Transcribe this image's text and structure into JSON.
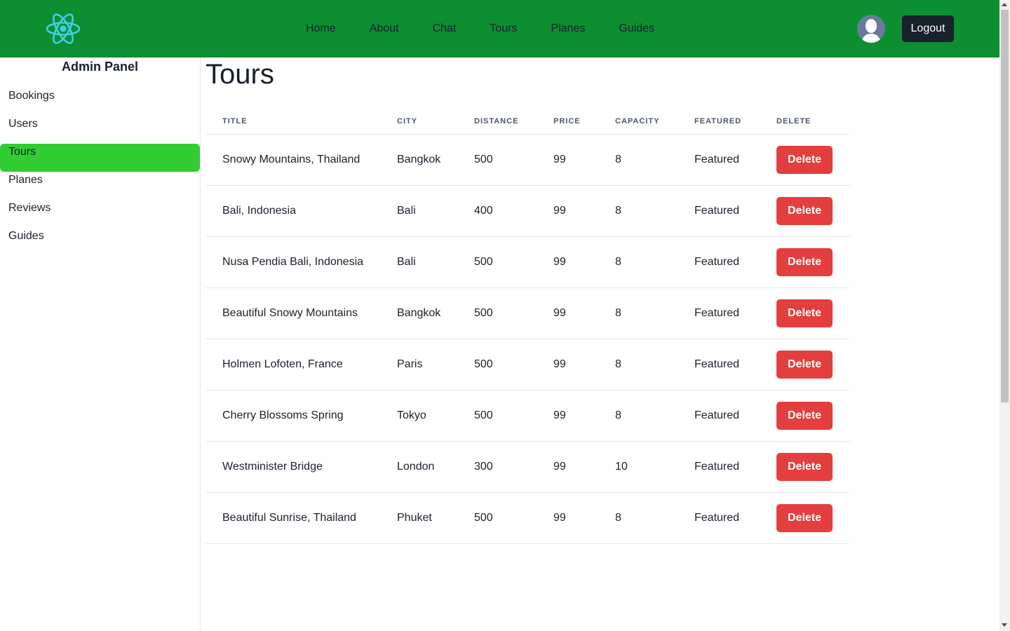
{
  "navbar": {
    "logo_icon": "react-atom-icon",
    "links": [
      "Home",
      "About",
      "Chat",
      "Tours",
      "Planes",
      "Guides"
    ],
    "avatar_icon": "user-avatar-icon",
    "logout_label": "Logout",
    "background_color": "#0c8e31"
  },
  "sidebar": {
    "title": "Admin Panel",
    "items": [
      {
        "label": "Bookings",
        "active": false
      },
      {
        "label": "Users",
        "active": false
      },
      {
        "label": "Tours",
        "active": true
      },
      {
        "label": "Planes",
        "active": false
      },
      {
        "label": "Reviews",
        "active": false
      },
      {
        "label": "Guides",
        "active": false
      }
    ],
    "active_color": "#32cd32"
  },
  "main": {
    "title": "Tours",
    "table": {
      "headers": [
        "TITLE",
        "CITY",
        "DISTANCE",
        "PRICE",
        "CAPACITY",
        "FEATURED",
        "DELETE"
      ],
      "rows": [
        {
          "title": "Snowy Mountains, Thailand",
          "city": "Bangkok",
          "distance": "500",
          "price": "99",
          "capacity": "8",
          "featured": "Featured",
          "action": "Delete"
        },
        {
          "title": "Bali, Indonesia",
          "city": "Bali",
          "distance": "400",
          "price": "99",
          "capacity": "8",
          "featured": "Featured",
          "action": "Delete"
        },
        {
          "title": "Nusa Pendia Bali, Indonesia",
          "city": "Bali",
          "distance": "500",
          "price": "99",
          "capacity": "8",
          "featured": "Featured",
          "action": "Delete"
        },
        {
          "title": "Beautiful Snowy Mountains",
          "city": "Bangkok",
          "distance": "500",
          "price": "99",
          "capacity": "8",
          "featured": "Featured",
          "action": "Delete"
        },
        {
          "title": "Holmen Lofoten, France",
          "city": "Paris",
          "distance": "500",
          "price": "99",
          "capacity": "8",
          "featured": "Featured",
          "action": "Delete"
        },
        {
          "title": "Cherry Blossoms Spring",
          "city": "Tokyo",
          "distance": "500",
          "price": "99",
          "capacity": "8",
          "featured": "Featured",
          "action": "Delete"
        },
        {
          "title": "Westminister Bridge",
          "city": "London",
          "distance": "300",
          "price": "99",
          "capacity": "10",
          "featured": "Featured",
          "action": "Delete"
        },
        {
          "title": "Beautiful Sunrise, Thailand",
          "city": "Phuket",
          "distance": "500",
          "price": "99",
          "capacity": "8",
          "featured": "Featured",
          "action": "Delete"
        }
      ]
    },
    "delete_color": "#e53e3e"
  }
}
